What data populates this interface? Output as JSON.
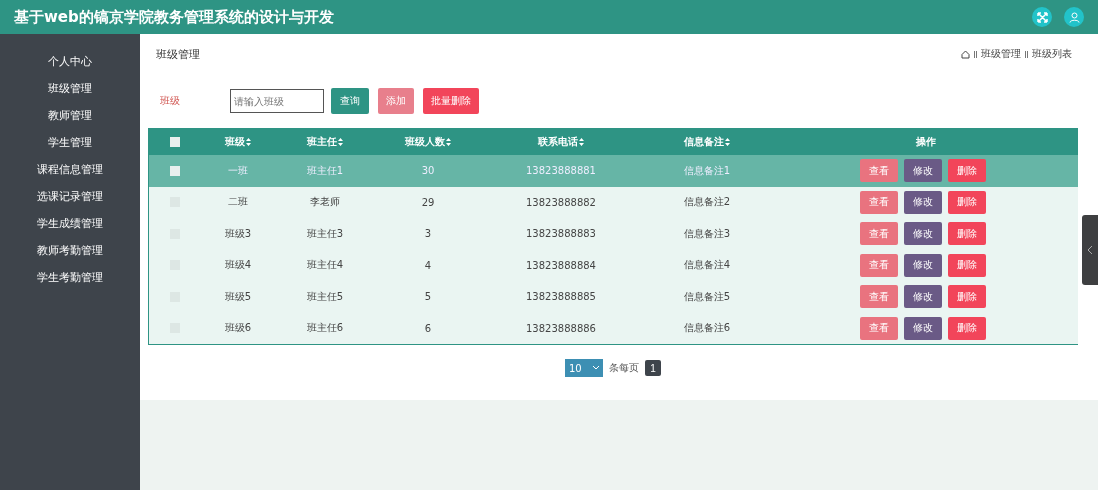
{
  "header": {
    "title": "基于web的镐京学院教务管理系统的设计与开发"
  },
  "sidebar": {
    "items": [
      {
        "label": "个人中心",
        "selected": false
      },
      {
        "label": "班级管理",
        "selected": false
      },
      {
        "label": "教师管理",
        "selected": false
      },
      {
        "label": "学生管理",
        "selected": false
      },
      {
        "label": "课程信息管理",
        "selected": false
      },
      {
        "label": "选课记录管理",
        "selected": false
      },
      {
        "label": "学生成绩管理",
        "selected": false
      },
      {
        "label": "教师考勤管理",
        "selected": false
      },
      {
        "label": "学生考勤管理",
        "selected": false
      }
    ]
  },
  "page_title": "班级管理",
  "breadcrumb": [
    "班级管理",
    "班级列表"
  ],
  "search": {
    "label": "班级",
    "placeholder": "请输入班级",
    "buttons": [
      {
        "label": "查询",
        "kind": "query"
      },
      {
        "label": "添加",
        "kind": "add"
      },
      {
        "label": "批量删除",
        "kind": "delete"
      }
    ]
  },
  "table": {
    "header_checked": false,
    "columns": [
      {
        "label": "班级",
        "sortable": true
      },
      {
        "label": "班主任",
        "sortable": true
      },
      {
        "label": "班级人数",
        "sortable": true
      },
      {
        "label": "联系电话",
        "sortable": true
      },
      {
        "label": "信息备注",
        "sortable": true
      },
      {
        "label": "操作",
        "sortable": false
      }
    ],
    "rows": [
      {
        "cells": [
          "一班",
          "班主任1",
          "30",
          "13823888881",
          "信息备注1"
        ],
        "selected": true,
        "checked": false,
        "actions": [
          {
            "label": "查看",
            "kind": "view"
          },
          {
            "label": "修改",
            "kind": "edit"
          },
          {
            "label": "删除",
            "kind": "delete"
          }
        ]
      },
      {
        "cells": [
          "二班",
          "李老师",
          "29",
          "13823888882",
          "信息备注2"
        ],
        "selected": false,
        "checked": false,
        "actions": [
          {
            "label": "查看",
            "kind": "view"
          },
          {
            "label": "修改",
            "kind": "edit"
          },
          {
            "label": "删除",
            "kind": "delete"
          }
        ]
      },
      {
        "cells": [
          "班级3",
          "班主任3",
          "3",
          "13823888883",
          "信息备注3"
        ],
        "selected": false,
        "checked": false,
        "actions": [
          {
            "label": "查看",
            "kind": "view"
          },
          {
            "label": "修改",
            "kind": "edit"
          },
          {
            "label": "删除",
            "kind": "delete"
          }
        ]
      },
      {
        "cells": [
          "班级4",
          "班主任4",
          "4",
          "13823888884",
          "信息备注4"
        ],
        "selected": false,
        "checked": false,
        "actions": [
          {
            "label": "查看",
            "kind": "view"
          },
          {
            "label": "修改",
            "kind": "edit"
          },
          {
            "label": "删除",
            "kind": "delete"
          }
        ]
      },
      {
        "cells": [
          "班级5",
          "班主任5",
          "5",
          "13823888885",
          "信息备注5"
        ],
        "selected": false,
        "checked": false,
        "actions": [
          {
            "label": "查看",
            "kind": "view"
          },
          {
            "label": "修改",
            "kind": "edit"
          },
          {
            "label": "删除",
            "kind": "delete"
          }
        ]
      },
      {
        "cells": [
          "班级6",
          "班主任6",
          "6",
          "13823888886",
          "信息备注6"
        ],
        "selected": false,
        "checked": false,
        "actions": [
          {
            "label": "查看",
            "kind": "view"
          },
          {
            "label": "修改",
            "kind": "edit"
          },
          {
            "label": "删除",
            "kind": "delete"
          }
        ]
      }
    ]
  },
  "pagination": {
    "page_size": "10",
    "page_size_label": "条每页",
    "pages": [
      {
        "label": "1",
        "selected": true
      }
    ]
  }
}
